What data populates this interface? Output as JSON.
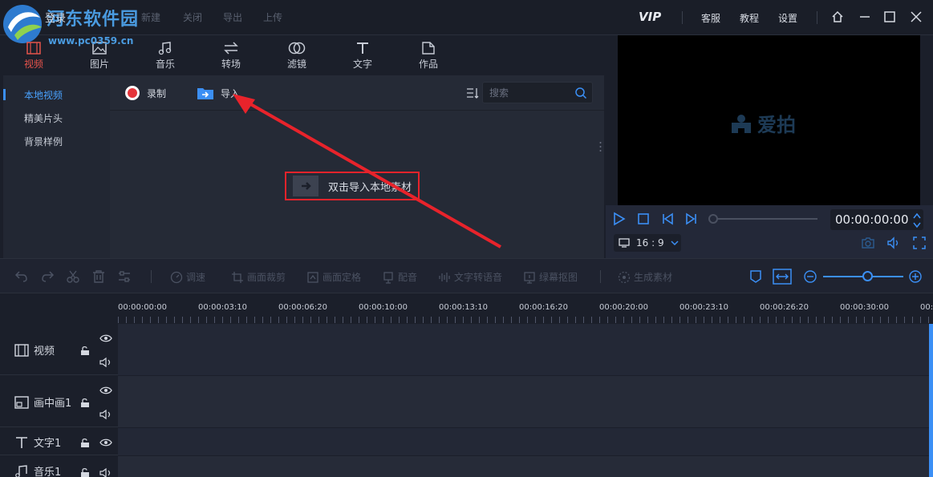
{
  "watermark": {
    "site": "河东软件园",
    "url": "www.pc0359.cn"
  },
  "titlebar": {
    "login": "登录",
    "menu": [
      "新建",
      "关闭",
      "导出",
      "上传"
    ],
    "vip": "VIP",
    "service": "客服",
    "tutorial": "教程",
    "settings": "设置"
  },
  "media_tabs": [
    {
      "label": "视频",
      "icon": "video-icon",
      "active": true
    },
    {
      "label": "图片",
      "icon": "image-icon"
    },
    {
      "label": "音乐",
      "icon": "music-icon"
    },
    {
      "label": "转场",
      "icon": "transition-icon"
    },
    {
      "label": "滤镜",
      "icon": "filter-icon"
    },
    {
      "label": "文字",
      "icon": "text-icon"
    },
    {
      "label": "作品",
      "icon": "works-icon"
    }
  ],
  "sidebar": {
    "items": [
      "本地视频",
      "精美片头",
      "背景样例"
    ]
  },
  "media": {
    "record": "录制",
    "import": "导入",
    "search_placeholder": "搜索",
    "drop_hint": "双击导入本地素材"
  },
  "preview": {
    "brand": "爱拍",
    "timecode": "00:00:00:00",
    "aspect": "16 : 9"
  },
  "edit_toolbar": {
    "speed": "调速",
    "crop": "画面裁剪",
    "freeze": "画面定格",
    "dub": "配音",
    "tts": "文字转语音",
    "greenscreen": "绿幕抠图",
    "generate": "生成素材"
  },
  "timeline": {
    "ticks": [
      "00:00:00:00",
      "00:00:03:10",
      "00:00:06:20",
      "00:00:10:00",
      "00:00:13:10",
      "00:00:16:20",
      "00:00:20:00",
      "00:00:23:10",
      "00:00:26:20",
      "00:00:30:00",
      "00:0"
    ],
    "tracks": [
      "视频",
      "画中画1",
      "文字1",
      "音乐1"
    ]
  },
  "colors": {
    "accent": "#3b8ff5",
    "active_tab": "#e5534b",
    "highlight": "#e8232b"
  }
}
